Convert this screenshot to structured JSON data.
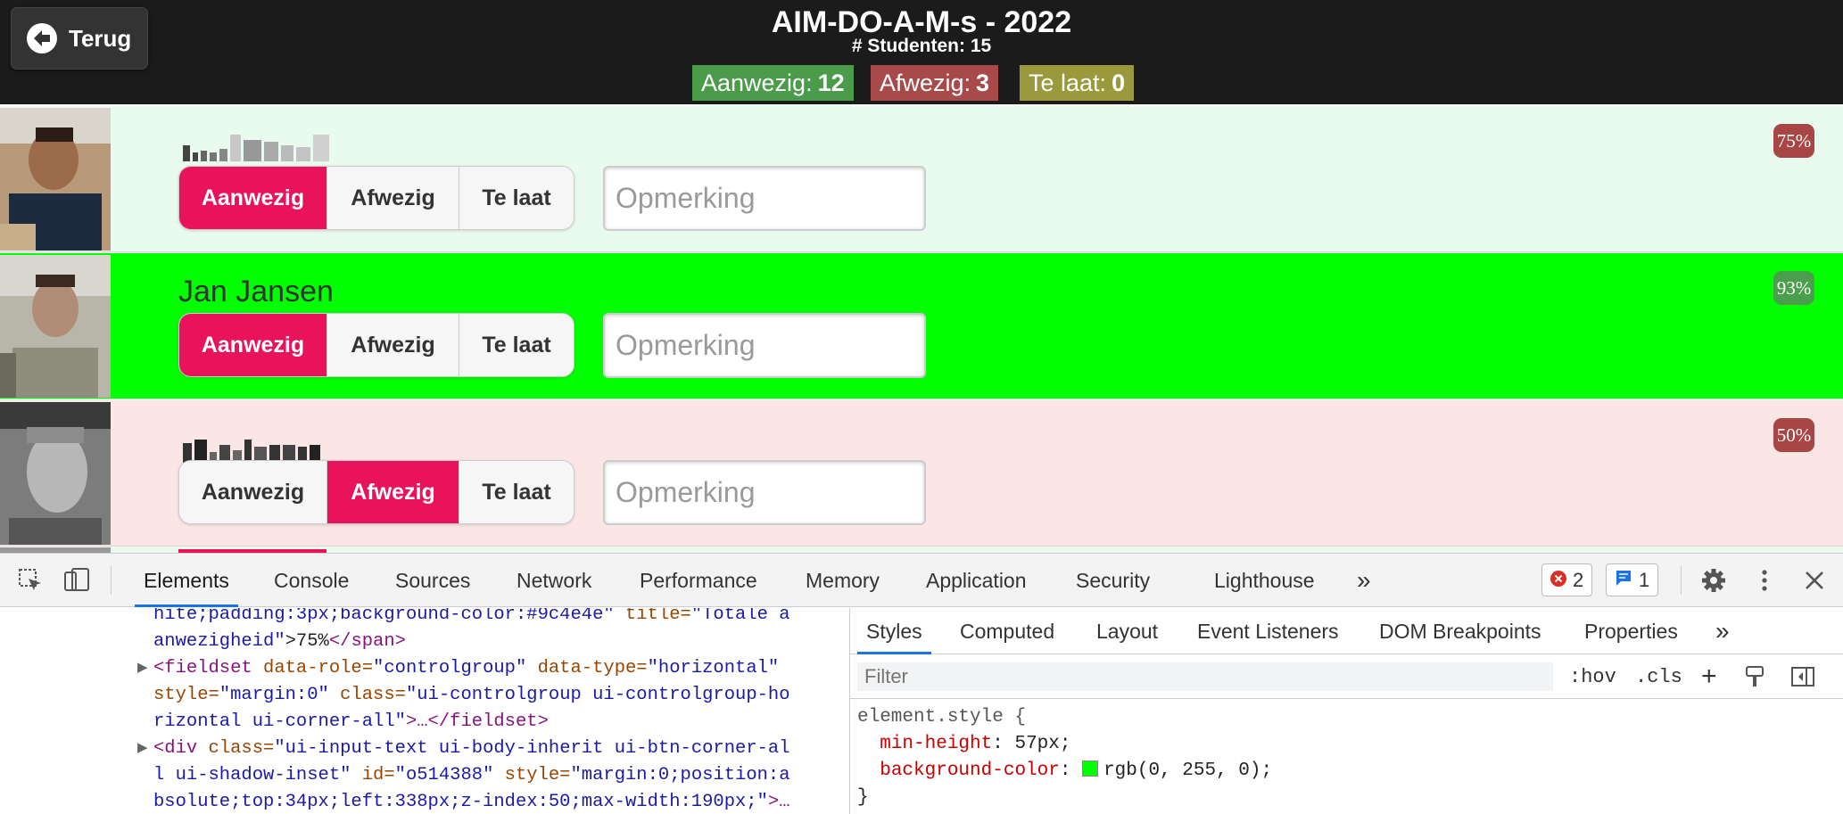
{
  "header": {
    "back_label": "Terug",
    "title": "AIM-DO-A-M-s - 2022",
    "subtitle": "# Studenten: 15",
    "stats": {
      "present_label": "Aanwezig:",
      "present_count": "12",
      "present_color": "#4a9b4a",
      "absent_label": "Afwezig:",
      "absent_count": "3",
      "absent_color": "#a84a4a",
      "late_label": "Te laat:",
      "late_count": "0",
      "late_color": "#9a9a3c"
    }
  },
  "options": {
    "present": "Aanwezig",
    "absent": "Afwezig",
    "late": "Te laat"
  },
  "remark_placeholder": "Opmerking",
  "students": [
    {
      "name": "",
      "status": "Aanwezig",
      "attendance": "75%",
      "row_color": "#e9fbee",
      "badge_color": "#a84545"
    },
    {
      "name": "Jan Jansen",
      "status": "Aanwezig",
      "attendance": "93%",
      "row_color": "#00ff00",
      "badge_color": "#4b9e4b"
    },
    {
      "name": "",
      "status": "Afwezig",
      "attendance": "50%",
      "row_color": "#fbe6e6",
      "badge_color": "#a84545"
    }
  ],
  "devtools": {
    "tabs": [
      "Elements",
      "Console",
      "Sources",
      "Network",
      "Performance",
      "Memory",
      "Application",
      "Security",
      "Lighthouse"
    ],
    "more": "»",
    "errors": "2",
    "messages": "1",
    "code": {
      "l1_a": "hite;padding:3px;background-color:#9c4e4e\"",
      "l1_b": " title=",
      "l1_c": "\"Totale a",
      "l2_a": "anwezigheid\"",
      "l2_b": ">75%",
      "l2_c": "</span>",
      "l3_a": "<fieldset",
      "l3_b": " data-role=",
      "l3_c": "\"controlgroup\"",
      "l3_d": " data-type=",
      "l3_e": "\"horizontal\"",
      "l4_a": "style=",
      "l4_b": "\"margin:0\"",
      "l4_c": " class=",
      "l4_d": "\"ui-controlgroup ui-controlgroup-ho",
      "l5_a": "rizontal ui-corner-all\"",
      "l5_b": ">…</fieldset>",
      "l6_a": "<div",
      "l6_b": " class=",
      "l6_c": "\"ui-input-text ui-body-inherit ui-btn-corner-al",
      "l7_a": "l ui-shadow-inset\"",
      "l7_b": " id=",
      "l7_c": "\"o514388\"",
      "l7_d": " style=",
      "l7_e": "\"margin:0;position:a",
      "l8_a": "bsolute;top:34px;left:338px;z-index:50;max-width:190px;\"",
      "l8_b": ">…"
    },
    "styles_tabs": [
      "Styles",
      "Computed",
      "Layout",
      "Event Listeners",
      "DOM Breakpoints",
      "Properties"
    ],
    "filter_placeholder": "Filter",
    "hov": ":hov",
    "cls": ".cls",
    "rule": {
      "selector": "element.style {",
      "p1_name": "min-height",
      "p1_value": "57px;",
      "p2_name": "background-color",
      "p2_value": "rgb(0, 255, 0);",
      "swatch_color": "#00ff00",
      "close": "}"
    }
  }
}
